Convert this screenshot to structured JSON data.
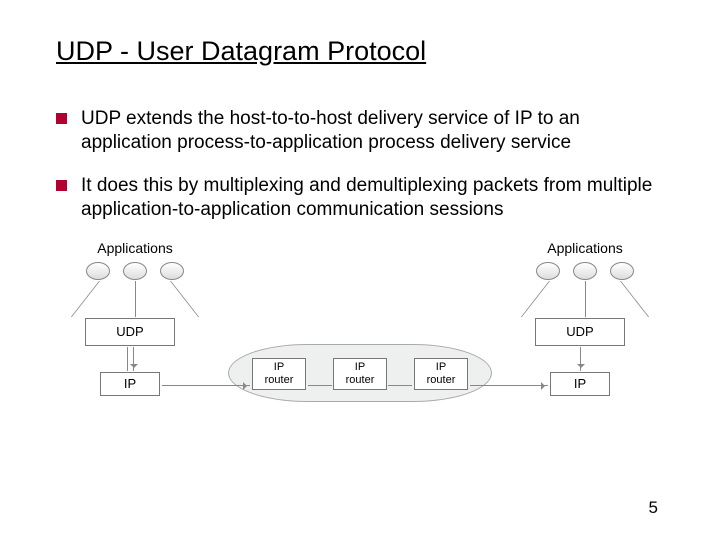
{
  "title": "UDP - User Datagram Protocol",
  "bullets": [
    "UDP extends the host-to-to-host delivery service of  IP to an application process-to-application process delivery service",
    "It does this by multiplexing and demultiplexing packets from multiple application-to-application communication sessions"
  ],
  "diagram": {
    "apps_label": "Applications",
    "udp_label": "UDP",
    "ip_label": "IP",
    "router_line1": "IP",
    "router_line2": "router"
  },
  "page_number": "5"
}
